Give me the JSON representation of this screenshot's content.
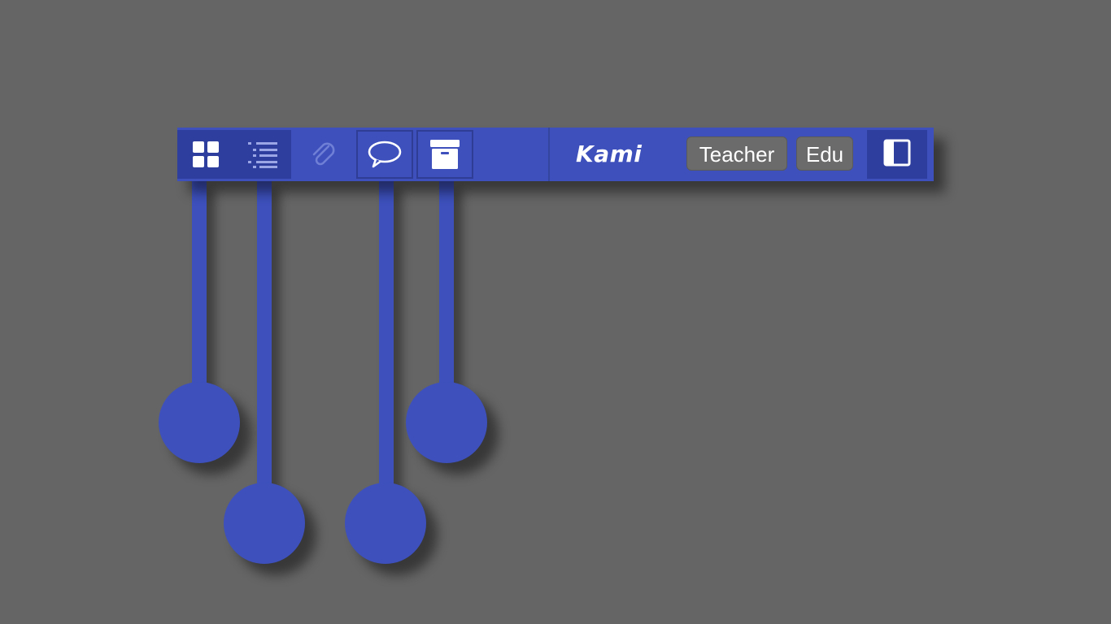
{
  "toolbar": {
    "brand": "Kami",
    "badges": {
      "teacher": "Teacher",
      "edu": "Edu"
    },
    "buttons": [
      {
        "name": "grid-view-button",
        "icon": "grid-icon"
      },
      {
        "name": "outline-list-button",
        "icon": "list-icon"
      },
      {
        "name": "attachment-button",
        "icon": "paperclip-icon"
      },
      {
        "name": "comments-button",
        "icon": "speech-bubble-icon"
      },
      {
        "name": "archive-button",
        "icon": "archive-box-icon"
      },
      {
        "name": "toggle-sidebar-button",
        "icon": "sidebar-panel-icon"
      }
    ]
  },
  "colors": {
    "background": "#656565",
    "toolbar": "#3d50bc",
    "toolbar_dark": "#2e3e9e",
    "badge": "#6b6b6b",
    "icon": "#ffffff"
  }
}
